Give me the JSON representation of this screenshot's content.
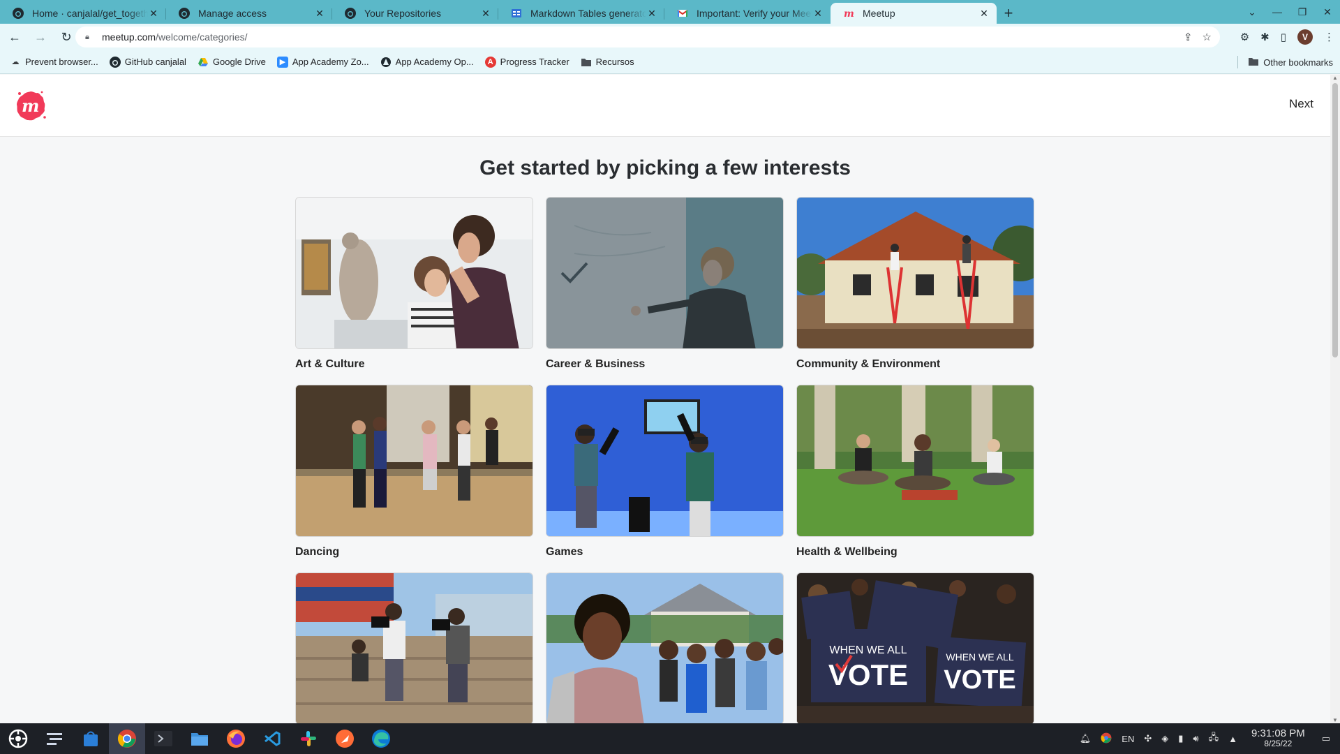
{
  "browser": {
    "tabs": [
      {
        "title": "Home · canjalal/get_together",
        "icon": "github-icon"
      },
      {
        "title": "Manage access",
        "icon": "github-icon"
      },
      {
        "title": "Your Repositories",
        "icon": "github-icon"
      },
      {
        "title": "Markdown Tables generator",
        "icon": "table-generator-icon"
      },
      {
        "title": "Important: Verify your Meetup",
        "icon": "gmail-icon"
      },
      {
        "title": "Meetup",
        "icon": "meetup-icon",
        "active": true
      }
    ],
    "url_host": "meetup.com",
    "url_path": "/welcome/categories/",
    "avatar_letter": "V",
    "bookmarks": [
      {
        "label": "Prevent browser...",
        "icon": "cloud-icon"
      },
      {
        "label": "GitHub canjalal",
        "icon": "github-icon"
      },
      {
        "label": "Google Drive",
        "icon": "google-drive-icon"
      },
      {
        "label": "App Academy Zo...",
        "icon": "zoom-icon"
      },
      {
        "label": "App Academy Op...",
        "icon": "app-academy-icon"
      },
      {
        "label": "Progress Tracker",
        "icon": "progress-tracker-icon"
      },
      {
        "label": "Recursos",
        "icon": "folder-icon"
      }
    ],
    "other_bookmarks": "Other bookmarks"
  },
  "page": {
    "next_label": "Next",
    "heading": "Get started by picking a few interests",
    "categories": [
      {
        "label": "Art & Culture",
        "selected": false
      },
      {
        "label": "Career & Business",
        "selected": true
      },
      {
        "label": "Community & Environment",
        "selected": false
      },
      {
        "label": "Dancing",
        "selected": false
      },
      {
        "label": "Games",
        "selected": false
      },
      {
        "label": "Health & Wellbeing",
        "selected": false
      },
      {
        "label": "",
        "selected": false
      },
      {
        "label": "",
        "selected": false
      },
      {
        "label": "",
        "selected": false
      }
    ],
    "vote_sign_line1": "WHEN WE ALL",
    "vote_sign_line2": "VOTE"
  },
  "colors": {
    "meetup_red": "#f13a59",
    "tab_bar": "#5bb8c8",
    "toolbar": "#e8f7fa",
    "page_bg": "#f6f7f8"
  },
  "taskbar": {
    "language": "EN",
    "time": "9:31:08 PM",
    "date": "8/25/22"
  }
}
